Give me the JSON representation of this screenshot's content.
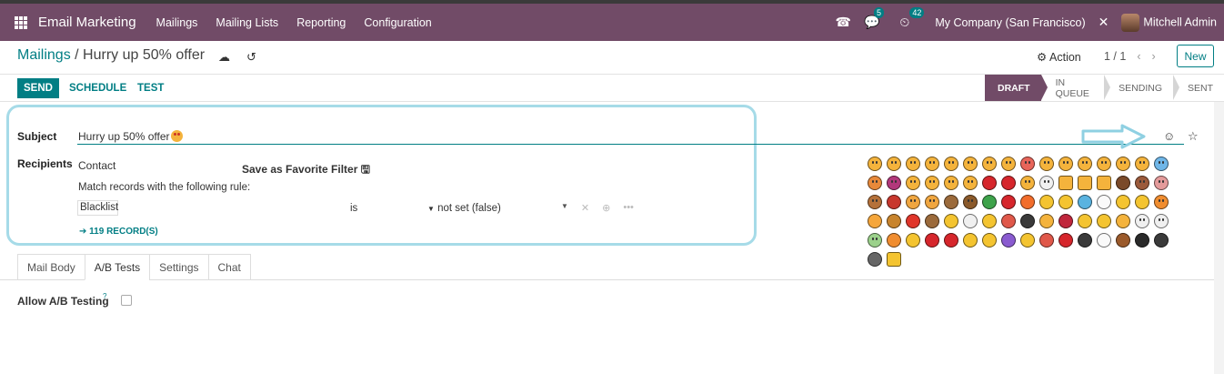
{
  "navbar": {
    "app_name": "Email Marketing",
    "menus": [
      "Mailings",
      "Mailing Lists",
      "Reporting",
      "Configuration"
    ],
    "chat_count": "5",
    "activity_count": "42",
    "company": "My Company (San Francisco)",
    "user": "Mitchell Admin"
  },
  "breadcrumb": {
    "parent": "Mailings",
    "separator": "/",
    "current": "Hurry up 50% offer"
  },
  "control": {
    "action_label": "Action",
    "pager": "1 / 1",
    "new_label": "New"
  },
  "buttons": {
    "send": "SEND",
    "schedule": "SCHEDULE",
    "test": "TEST"
  },
  "status": {
    "stages": [
      "DRAFT",
      "IN QUEUE",
      "SENDING",
      "SENT"
    ],
    "active": "DRAFT"
  },
  "form": {
    "subject_label": "Subject",
    "subject_value": "Hurry up 50% offer",
    "recipients_label": "Recipients",
    "recipients_value": "Contact",
    "save_filter_label": "Save as Favorite Filter",
    "rule_intro": "Match records with the following rule:",
    "rule_field": "Blacklist",
    "rule_operator": "is",
    "rule_value": "not set (false)",
    "records_link": "119 RECORD(S)"
  },
  "tabs": [
    "Mail Body",
    "A/B Tests",
    "Settings",
    "Chat"
  ],
  "active_tab": "A/B Tests",
  "ab": {
    "label": "Allow A/B Testing",
    "help": "?",
    "checked": false
  },
  "colors": {
    "brand": "#714B67",
    "accent": "#017e84",
    "highlight": "#a6dbe8"
  }
}
